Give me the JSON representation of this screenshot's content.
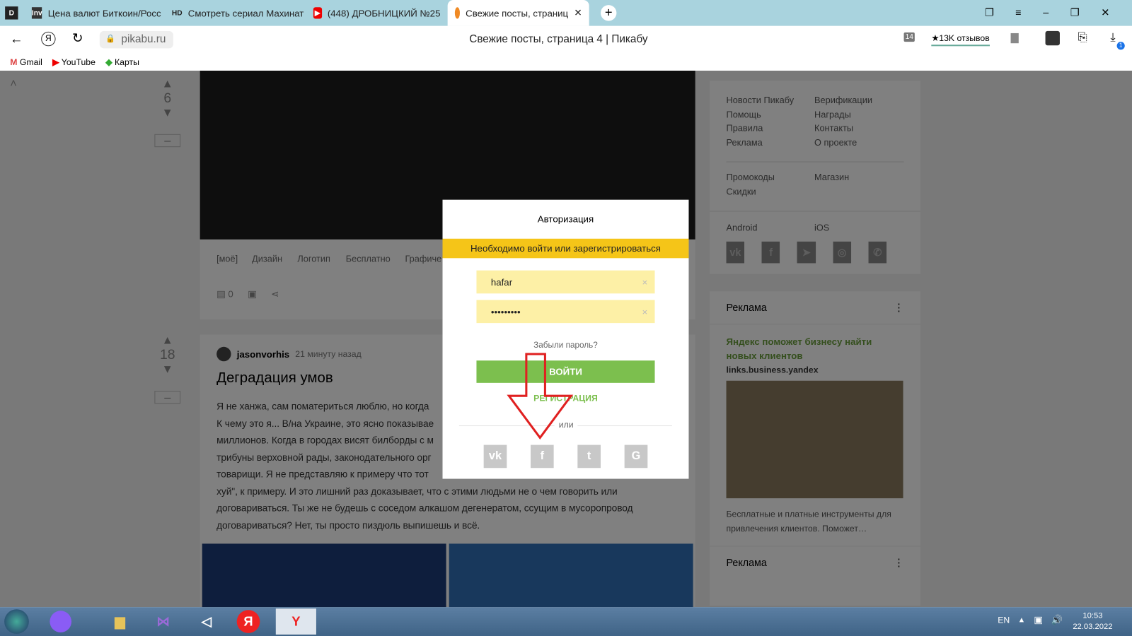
{
  "browser": {
    "tabs": [
      {
        "icon": "Inv",
        "title": "Цена валют Биткоин/Росс"
      },
      {
        "icon": "HD",
        "title": "Смотреть сериал Махинат"
      },
      {
        "icon": "▶",
        "title": "(448) ДРОБНИЦКИЙ №25"
      },
      {
        "icon": "",
        "title": "Свежие посты, страниц"
      }
    ],
    "url": "pikabu.ru",
    "page_title": "Свежие посты, страница 4 | Пикабу",
    "reviews": "★13K отзывов",
    "badge_count": "14",
    "downloads_count": "1",
    "bookmarks": [
      "Gmail",
      "YouTube",
      "Карты"
    ]
  },
  "feed": {
    "post1": {
      "rating": "6",
      "tags": [
        "[моё]",
        "Дизайн",
        "Логотип",
        "Бесплатно",
        "Графиче"
      ],
      "comments": "0"
    },
    "post2": {
      "rating": "18",
      "author": "jasonvorhis",
      "time": "21 минуту назад",
      "title": "Деградация умов",
      "lines": [
        "Я не ханжа, сам поматериться люблю, но когда",
        "К чему это я... В/на Украине, это ясно показывае",
        "миллионов. Когда в городах висят билборды с м",
        "трибуны верховной рады, законодательного орг",
        "товарищи. Я не представляю к примеру что тот",
        "хуй\", к примеру. И это лишний раз доказывает, что с этими людьми не о чем говорить или",
        "договариваться. Ты же не будешь с соседом алкашом дегенератом, ссущим в мусоропровод",
        "договариваться? Нет, ты просто пиздюль выпишешь и всё."
      ]
    }
  },
  "sidebar": {
    "links_left": [
      "Новости Пикабу",
      "Помощь",
      "Правила",
      "Реклама"
    ],
    "links_right": [
      "Верификации",
      "Награды",
      "Контакты",
      "О проекте"
    ],
    "links2_left": [
      "Промокоды",
      "Скидки"
    ],
    "links2_right": [
      "Магазин"
    ],
    "apps": [
      "Android",
      "iOS"
    ],
    "ad_header": "Реклама",
    "ad_title": "Яндекс поможет бизнесу найти новых клиентов",
    "ad_domain": "links.business.yandex",
    "ad_text": "Бесплатные и платные инструменты для привлечения клиентов. Поможет…",
    "ad_header2": "Реклама"
  },
  "modal": {
    "title": "Авторизация",
    "banner": "Необходимо войти или зарегистрироваться",
    "login": "hafar",
    "password": "•••••••••",
    "forgot": "Забыли пароль?",
    "submit": "ВОЙТИ",
    "register": "РЕГИСТРАЦИЯ",
    "or": "или"
  },
  "taskbar": {
    "lang": "EN",
    "time": "10:53",
    "date": "22.03.2022"
  }
}
